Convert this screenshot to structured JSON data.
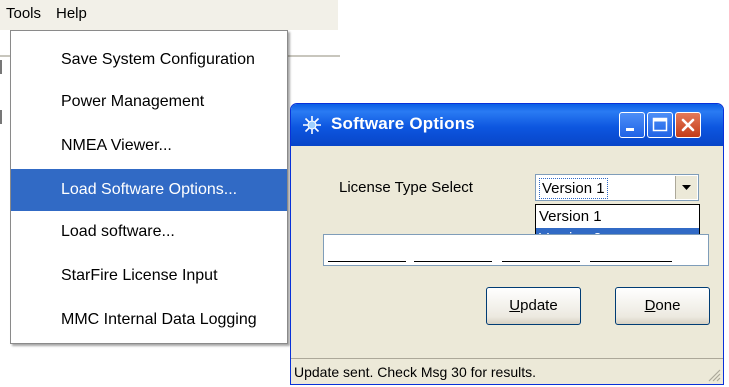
{
  "menubar": {
    "tools": "Tools",
    "help": "Help"
  },
  "tools_menu": {
    "items": [
      "Save System Configuration",
      "Power Management",
      "NMEA Viewer...",
      "Load Software Options...",
      "Load software...",
      "StarFire License Input",
      "MMC Internal Data Logging"
    ],
    "selected_index": 3
  },
  "dialog": {
    "title": "Software Options",
    "license_label": "License Type Select",
    "license_value": "Version 1",
    "license_options": [
      "Version 1",
      "Version 2"
    ],
    "highlighted_option": "Version 2",
    "update_label": "Update",
    "done_label": "Done",
    "status": "Update sent. Check Msg 30 for results."
  },
  "colors": {
    "title_bar": "#0a5fe6",
    "selection": "#316ac5",
    "dialog_face": "#ece9d8",
    "close_button": "#c33b17"
  },
  "icons": {
    "title": "sparkle-icon",
    "minimize": "minimize-icon",
    "maximize": "maximize-icon",
    "close": "close-icon",
    "combo_arrow": "chevron-down-icon",
    "resize": "resize-grip-icon"
  }
}
